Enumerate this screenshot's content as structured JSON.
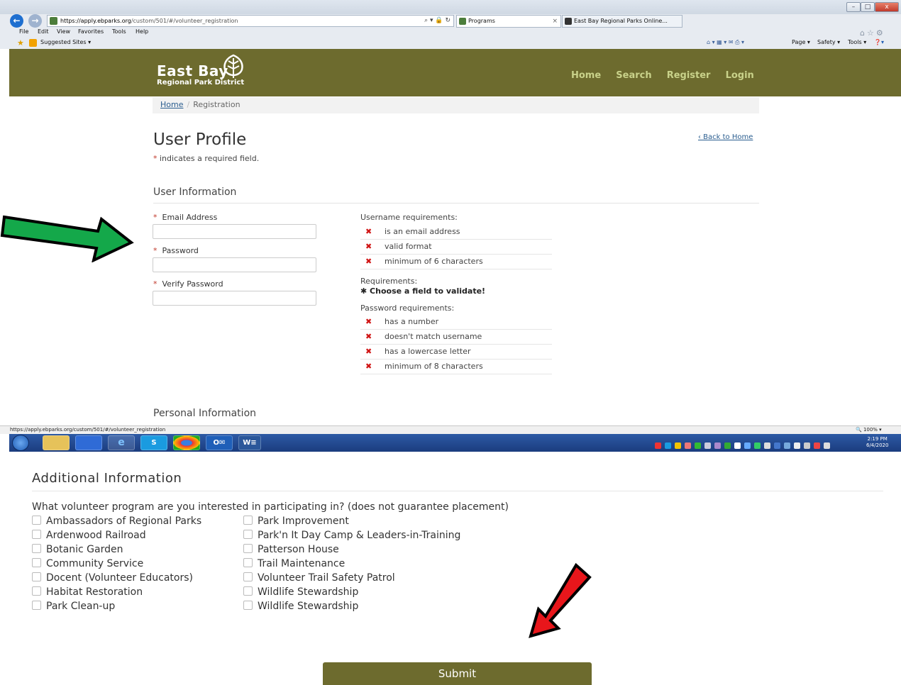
{
  "browser": {
    "address_url": "https://apply.ebparks.org/custom/501/#/volunteer_registration",
    "address_host": "https://apply.ebparks.org",
    "address_path": "/custom/501/#/volunteer_registration",
    "address_tools": "⌕ ▾ 🔒 ↻",
    "tabs": [
      {
        "label": "Programs",
        "close": "×"
      },
      {
        "label": "East Bay Regional Parks Online..."
      }
    ],
    "menu": [
      "File",
      "Edit",
      "View",
      "Favorites",
      "Tools",
      "Help"
    ],
    "suggested_sites": "Suggested Sites ▾",
    "command_bar": [
      "Page ▾",
      "Safety ▾",
      "Tools ▾"
    ],
    "window_buttons": [
      "–",
      "□",
      "x"
    ],
    "status_url": "https://apply.ebparks.org/custom/501/#/volunteer_registration",
    "zoom": "🔍 100%  ▾",
    "clock_time": "2:19 PM",
    "clock_date": "6/4/2020",
    "taskbar_apps": [
      "",
      "",
      "",
      "e",
      "S",
      "",
      "O✉",
      "W≡"
    ]
  },
  "site": {
    "logo_title": "East Bay",
    "logo_subtitle": "Regional Park District",
    "nav": [
      "Home",
      "Search",
      "Register",
      "Login"
    ]
  },
  "breadcrumb": {
    "home": "Home",
    "sep": "/",
    "current": "Registration"
  },
  "page": {
    "title": "User Profile",
    "back_link": "‹ Back to Home",
    "required_star": "*",
    "required_note": " indicates a required field."
  },
  "user_info": {
    "heading": "User Information",
    "fields": [
      {
        "label": "Email Address",
        "value": ""
      },
      {
        "label": "Password",
        "value": ""
      },
      {
        "label": "Verify Password",
        "value": ""
      }
    ],
    "username_heading": "Username requirements:",
    "username_reqs": [
      "is an email address",
      "valid format",
      "minimum of 6 characters"
    ],
    "requirements_heading": "Requirements:",
    "choose_text": "✱  Choose a field to validate!",
    "password_heading": "Password requirements:",
    "password_reqs": [
      "has a number",
      "doesn't match username",
      "has a lowercase letter",
      "minimum of 8 characters"
    ],
    "fail_mark": "✖"
  },
  "personal_info": {
    "heading": "Personal Information"
  },
  "additional_info": {
    "heading": "Additional Information",
    "question": "What volunteer program are you interested in participating in? (does not guarantee placement)",
    "programs_left": [
      "Ambassadors of Regional Parks",
      "Ardenwood Railroad",
      "Botanic Garden",
      "Community Service",
      "Docent (Volunteer Educators)",
      "Habitat Restoration",
      "Park Clean-up"
    ],
    "programs_right": [
      "Park Improvement",
      "Park'n It Day Camp & Leaders-in-Training",
      "Patterson House",
      "Trail Maintenance",
      "Volunteer Trail Safety Patrol",
      "Wildlife Stewardship",
      "Wildlife Stewardship"
    ],
    "submit_label": "Submit"
  },
  "colors": {
    "brand_olive": "#6d6b2e",
    "nav_text": "#c9d28a",
    "error_red": "#d01414",
    "green_arrow": "#14a84a",
    "red_arrow": "#e8161b"
  }
}
